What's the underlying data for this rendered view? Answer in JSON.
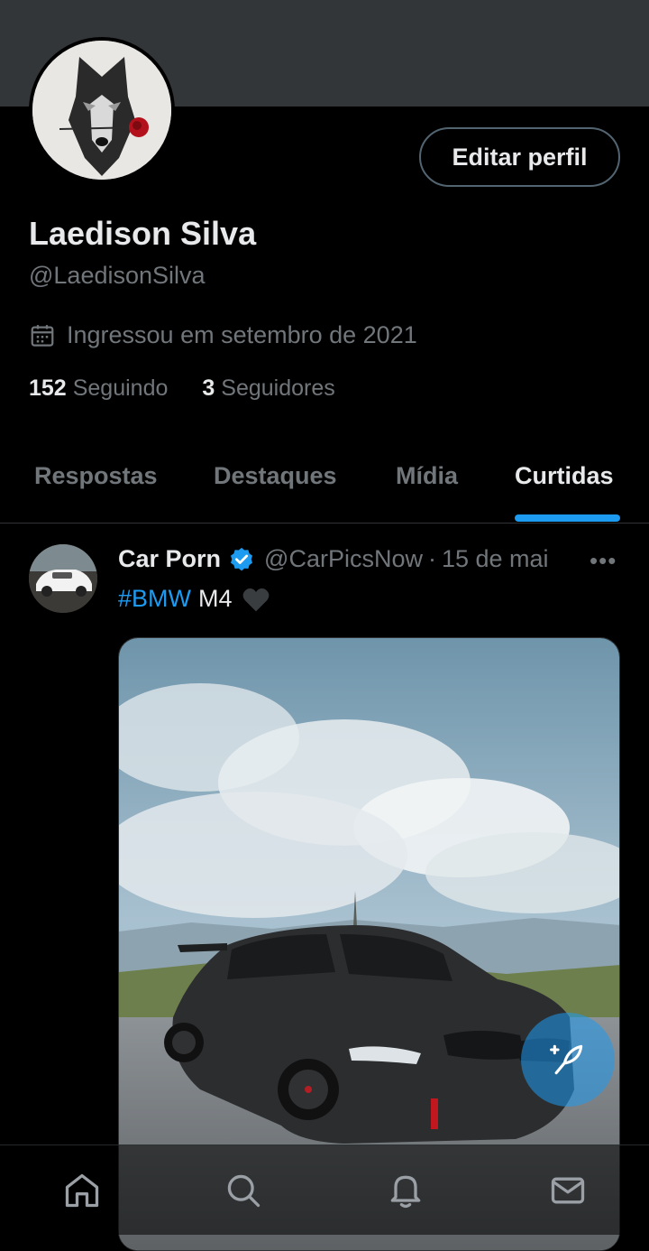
{
  "profile": {
    "name": "Laedison Silva",
    "handle": "@LaedisonSilva",
    "joined": "Ingressou em setembro de 2021",
    "edit_label": "Editar perfil",
    "following_count": "152",
    "following_label": "Seguindo",
    "followers_count": "3",
    "followers_label": "Seguidores"
  },
  "tabs": [
    {
      "label": "Respostas",
      "active": false
    },
    {
      "label": "Destaques",
      "active": false
    },
    {
      "label": "Mídia",
      "active": false
    },
    {
      "label": "Curtidas",
      "active": true
    }
  ],
  "post": {
    "author": "Car Porn",
    "handle": "@CarPicsNow",
    "separator": "·",
    "date": "15 de mai",
    "more_label": "•••",
    "hashtag": "#BMW",
    "text": "M4"
  },
  "nav": {
    "icons": [
      "home-icon",
      "search-icon",
      "notifications-icon",
      "messages-icon"
    ]
  },
  "colors": {
    "accent": "#1d9bf0",
    "background": "#000000",
    "banner": "#333639",
    "muted_text": "#71767b"
  }
}
